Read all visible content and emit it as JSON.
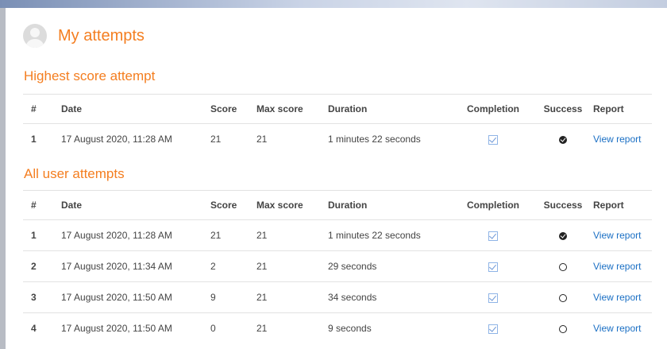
{
  "page": {
    "title": "My attempts"
  },
  "columns": {
    "num": "#",
    "date": "Date",
    "score": "Score",
    "max_score": "Max score",
    "duration": "Duration",
    "completion": "Completion",
    "success": "Success",
    "report": "Report"
  },
  "highest": {
    "title": "Highest score attempt",
    "rows": [
      {
        "num": "1",
        "date": "17 August 2020, 11:28 AM",
        "score": "21",
        "max_score": "21",
        "duration": "1 minutes 22 seconds",
        "completion": "checked",
        "success": "pass",
        "report": "View report"
      }
    ]
  },
  "all": {
    "title": "All user attempts",
    "rows": [
      {
        "num": "1",
        "date": "17 August 2020, 11:28 AM",
        "score": "21",
        "max_score": "21",
        "duration": "1 minutes 22 seconds",
        "completion": "checked",
        "success": "pass",
        "report": "View report"
      },
      {
        "num": "2",
        "date": "17 August 2020, 11:34 AM",
        "score": "2",
        "max_score": "21",
        "duration": "29 seconds",
        "completion": "checked",
        "success": "fail",
        "report": "View report"
      },
      {
        "num": "3",
        "date": "17 August 2020, 11:50 AM",
        "score": "9",
        "max_score": "21",
        "duration": "34 seconds",
        "completion": "checked",
        "success": "fail",
        "report": "View report"
      },
      {
        "num": "4",
        "date": "17 August 2020, 11:50 AM",
        "score": "0",
        "max_score": "21",
        "duration": "9 seconds",
        "completion": "checked",
        "success": "fail",
        "report": "View report"
      }
    ]
  },
  "colors": {
    "accent": "#f47e20",
    "link": "#1a6fc4"
  }
}
